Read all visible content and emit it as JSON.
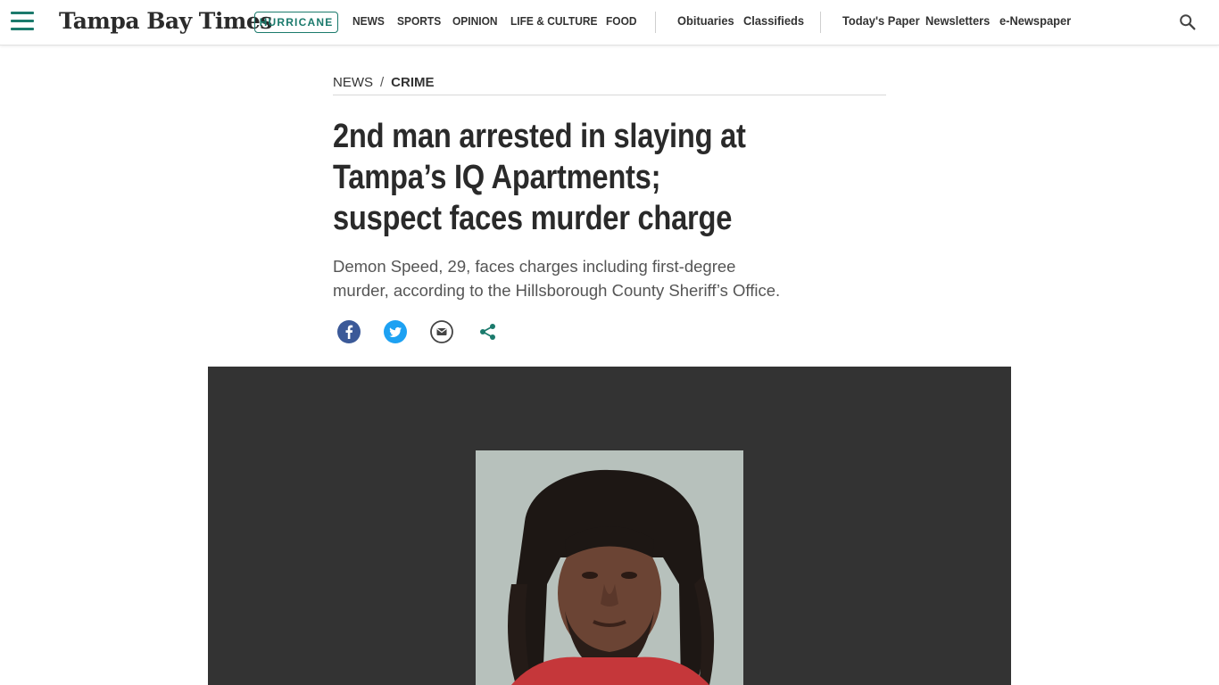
{
  "nav": {
    "logo": "Tampa Bay Times",
    "pill": "HURRICANE",
    "links": [
      "NEWS",
      "SPORTS",
      "OPINION",
      "LIFE & CULTURE",
      "FOOD"
    ],
    "secondary": [
      "Obituaries",
      "Classifieds"
    ],
    "tertiary": [
      "Today's Paper",
      "Newsletters",
      "e-Newspaper"
    ],
    "menu_icon": "hamburger-icon",
    "search_icon": "search-icon"
  },
  "breadcrumb": {
    "section": "NEWS",
    "separator": "/",
    "subsection": "CRIME"
  },
  "article": {
    "headline_lines": [
      "2nd man arrested in slaying at",
      "Tampa’s IQ Apartments;",
      "suspect faces murder charge"
    ],
    "dek_lines": [
      "Demon Speed, 29, faces charges including first-degree",
      "murder, according to the Hillsborough County Sheriff’s Office."
    ]
  },
  "share": {
    "icons": [
      "facebook-icon",
      "twitter-icon",
      "email-icon",
      "share-icon"
    ]
  },
  "colors": {
    "brand": "#1b7a6c",
    "facebook": "#3b5998",
    "twitter": "#1da1f2",
    "photo_bg": "#333333"
  }
}
